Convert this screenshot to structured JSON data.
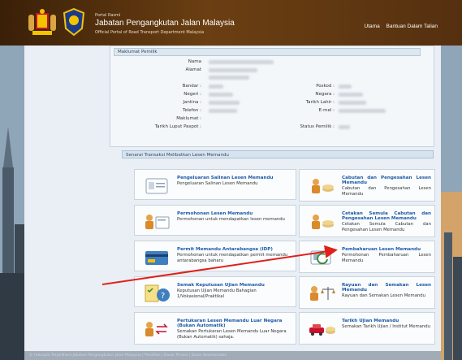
{
  "header": {
    "portal_small": "Portal Rasmi",
    "title": "Jabatan Pengangkutan Jalan Malaysia",
    "subtitle": "Official Portal of Road Transport Department Malaysia",
    "nav": [
      "Utama",
      "Bantuan Dalam Talian"
    ]
  },
  "owner": {
    "section_title": "Maklumat Pemilik",
    "fields_left": [
      {
        "label": "Nama"
      },
      {
        "label": "Alamat"
      },
      {
        "label": "Bandar :"
      },
      {
        "label": "Negeri :"
      },
      {
        "label": "Jantina :"
      },
      {
        "label": "Telefon :"
      },
      {
        "label": "Maklumat :"
      },
      {
        "label": "Tarikh Luput Paspot :"
      }
    ],
    "fields_right": [
      {
        "label": "Poskod :"
      },
      {
        "label": "Negara :"
      },
      {
        "label": "Tarikh Lahir :"
      },
      {
        "label": "E-mel :"
      },
      {
        "label": "Status Pemilik :"
      }
    ]
  },
  "transactions": {
    "section_title": "Senarai Transaksi Melibatkan Lesen Memandu",
    "items": [
      {
        "title": "Pengeluaran Salinan Lesen Memandu",
        "desc": "Pengeluaran Salinan Lesen Memandu",
        "icon": "license-card-icon"
      },
      {
        "title": "Cabutan dan Pengesahan Lesen Memandu",
        "desc": "Cabutan dan Pengesahan Lesen Memandu",
        "icon": "person-coins-icon"
      },
      {
        "title": "Permohonan Lesen Memandu",
        "desc": "Permohonan untuk mendapatkan lesen memandu",
        "icon": "person-card-icon"
      },
      {
        "title": "Cetakan Semula Cabutan dan Pengesahan Lesen Memandu",
        "desc": "Cetakan Semula Cabutan dan Pengesahan Lesen Memandu",
        "icon": "person-coins-icon"
      },
      {
        "title": "Permit Memandu Antarabangsa (IDP)",
        "desc": "Permohonan untuk mendapatkan permit memandu antarabangsa baharu",
        "icon": "credit-card-icon"
      },
      {
        "title": "Pembaharuan Lesen Memandu",
        "desc": "Permohonan Pembaharuan Lesen Memandu",
        "icon": "renew-license-icon"
      },
      {
        "title": "Semak Keputusan Ujian Memandu",
        "desc": "Keputusan Ujian Memandu Bahagian 1/Vokasional/Praktikal",
        "icon": "checklist-question-icon"
      },
      {
        "title": "Rayuan dan Semakan Lesen Memandu",
        "desc": "Rayuan dan Semakan Lesen Memandu",
        "icon": "scales-icon"
      },
      {
        "title": "Pertukaran Lesen Memandu Luar Negara (Bukan Automatik)",
        "desc": "Semakan Pertukaran Lesen Memandu Luar Negara (Bukan Automatik) sahaja.",
        "icon": "person-exchange-icon"
      },
      {
        "title": "Tarikh Ujian Memandu",
        "desc": "Semakan Tarikh Ujian / Institut Memandu",
        "icon": "car-coins-icon"
      }
    ]
  },
  "footer": {
    "text": "© Hakcipta Terpelihara Jabatan Pengangkutan Jalan Malaysia | Penafian | Dasar Privasi | Dasar Keselamatan"
  },
  "colors": {
    "header": "#5a3410",
    "link": "#1d5aa8",
    "arrow": "#e0201c"
  }
}
